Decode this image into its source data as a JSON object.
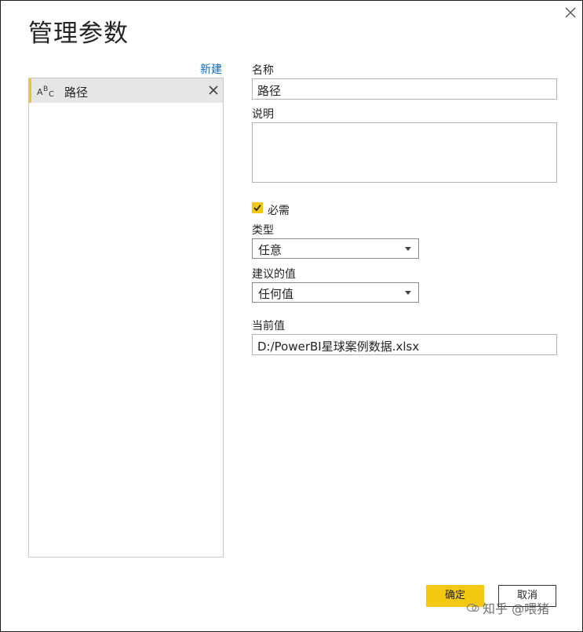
{
  "dialog": {
    "title": "管理参数",
    "close_icon": "close-icon"
  },
  "sidebar": {
    "new_label": "新建",
    "items": [
      {
        "type_icon": "text-type-icon",
        "label": "路径",
        "selected": true,
        "remove_icon": "remove-icon"
      }
    ]
  },
  "form": {
    "name_label": "名称",
    "name_value": "路径",
    "description_label": "说明",
    "description_value": "",
    "required_label": "必需",
    "required_checked": true,
    "type_label": "类型",
    "type_value": "任意",
    "suggested_label": "建议的值",
    "suggested_value": "任何值",
    "current_label": "当前值",
    "current_value": "D:/PowerBI星球案例数据.xlsx"
  },
  "footer": {
    "ok_label": "确定",
    "cancel_label": "取消"
  },
  "watermark": {
    "text": "知乎 @喂猪"
  },
  "colors": {
    "accent": "#f2c811",
    "link": "#0f6cbd",
    "selected_bg": "#e6e6e6"
  }
}
